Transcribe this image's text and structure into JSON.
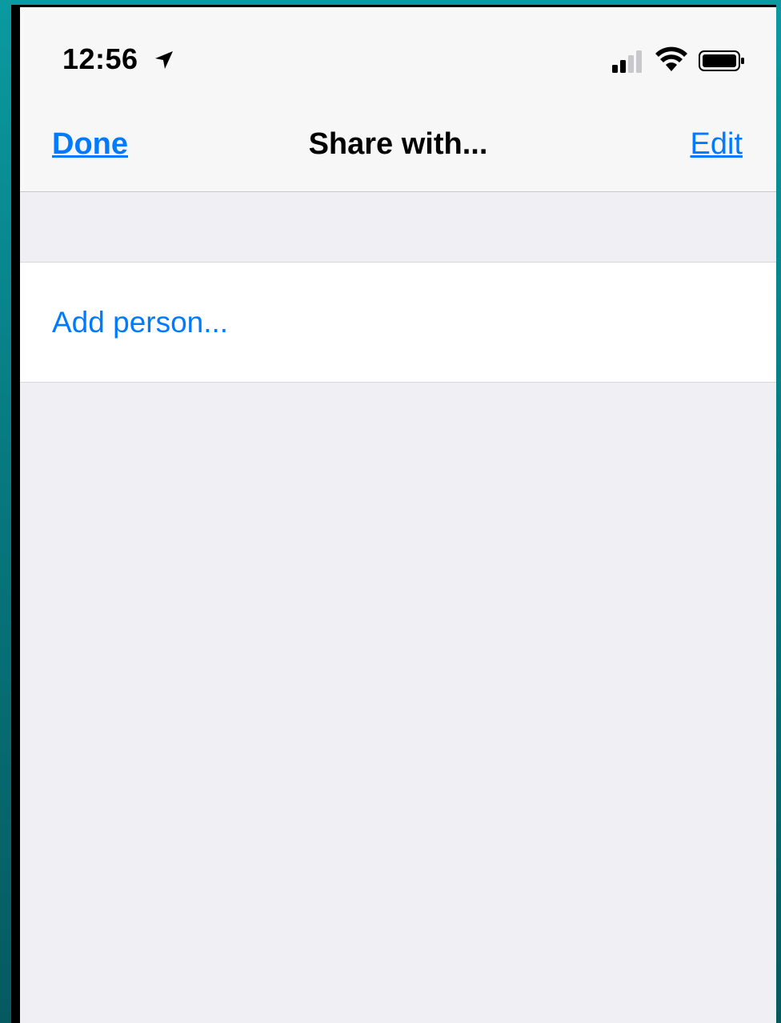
{
  "status_bar": {
    "time": "12:56",
    "icons": [
      "location-arrow-icon",
      "signal-icon",
      "wifi-icon",
      "battery-icon"
    ]
  },
  "nav": {
    "left_label": "Done",
    "title": "Share with...",
    "right_label": "Edit"
  },
  "list": {
    "items": [
      {
        "label": "Add person..."
      }
    ]
  },
  "colors": {
    "accent": "#007aff",
    "background": "#efeff4",
    "bar": "#f7f7f7"
  }
}
